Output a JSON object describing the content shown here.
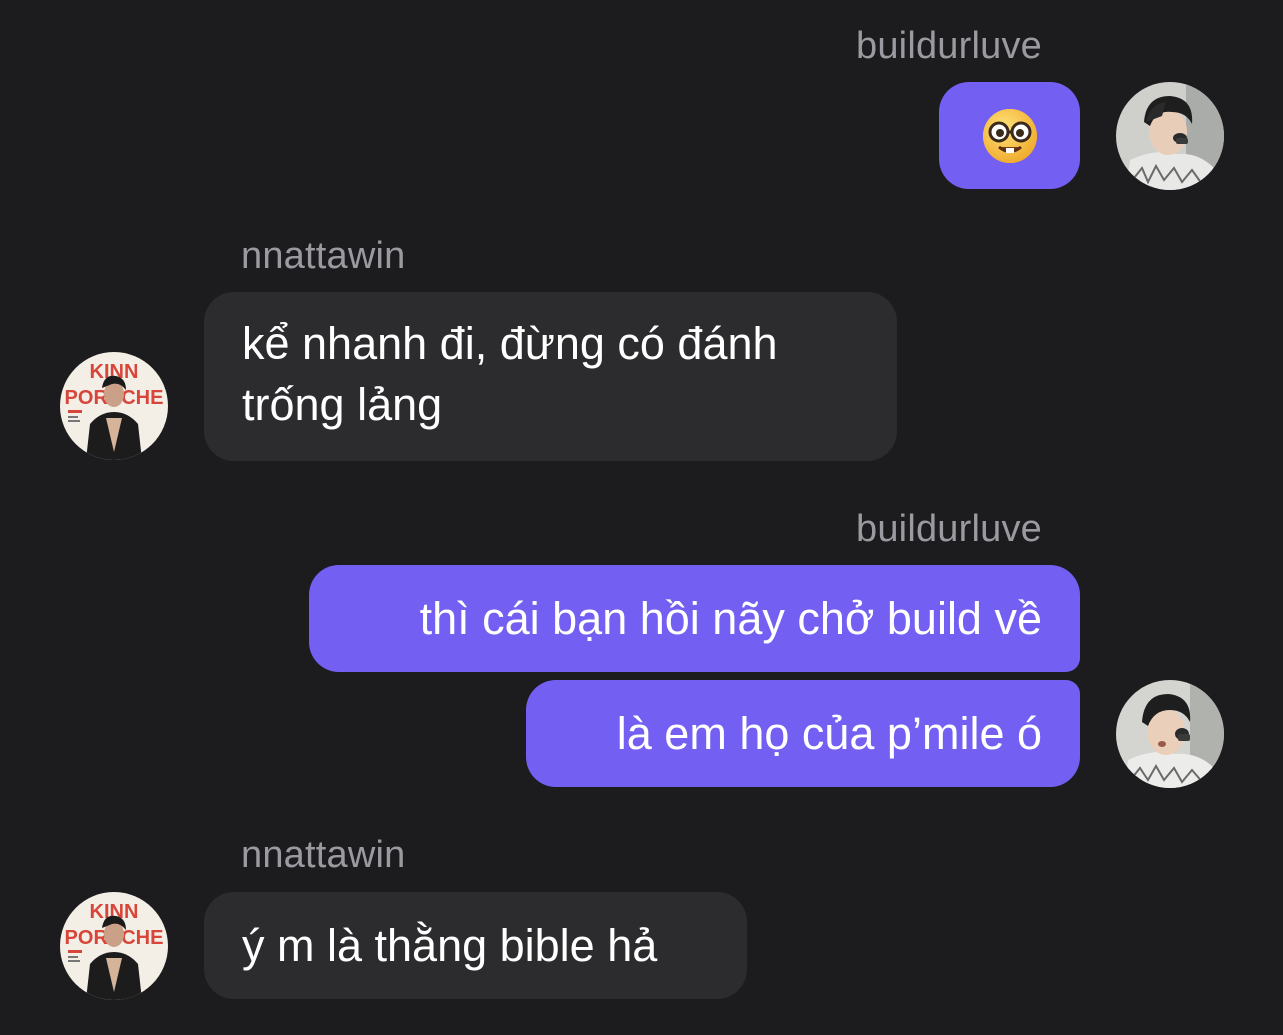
{
  "colors": {
    "background": "#1c1c1e",
    "outgoing_bubble": "#7360f2",
    "incoming_bubble": "#2c2c2e",
    "username": "#9a9aa0"
  },
  "messages": [
    {
      "sender": "buildurluve",
      "direction": "outgoing",
      "type": "emoji",
      "emoji": "nerd-face-emoji"
    },
    {
      "sender": "nnattawin",
      "direction": "incoming",
      "text": "kể nhanh đi, đừng có đánh trống lảng"
    },
    {
      "sender": "buildurluve",
      "direction": "outgoing",
      "text": "thì cái bạn hồi nãy chở build về"
    },
    {
      "sender": "buildurluve",
      "direction": "outgoing",
      "text": "là em họ của p’mile ó"
    },
    {
      "sender": "nnattawin",
      "direction": "incoming",
      "text": "ý m là thằng bible hả"
    }
  ],
  "avatars": {
    "nnattawin_poster_text_top": "KINN",
    "nnattawin_poster_text_mid": "PORSCHE"
  }
}
